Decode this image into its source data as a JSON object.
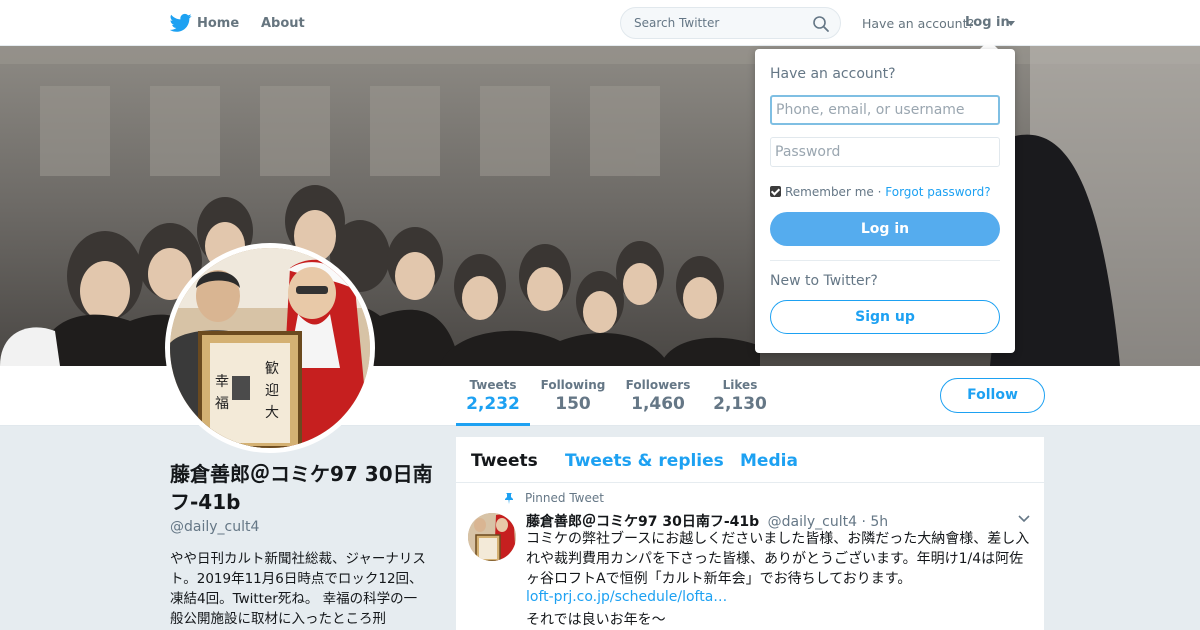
{
  "nav": {
    "home_label": "Home",
    "about_label": "About",
    "search_placeholder": "Search Twitter",
    "have_account": "Have an account?",
    "login_label": "Log in"
  },
  "icons": {
    "brand": "twitter-bird-icon",
    "search": "search-icon",
    "caret": "caret-down-icon",
    "pin": "pin-icon",
    "chevron": "chevron-down-icon"
  },
  "colors": {
    "accent": "#1da1f2",
    "login_button": "#55acee",
    "background": "#e6ecf0"
  },
  "profile": {
    "name": "藤倉善郎＠コミケ97 30日南フ-41b",
    "handle": "@daily_cult4",
    "bio": "やや日刊カルト新聞社総裁、ジャーナリスト。2019年11月6日時点でロック12回、凍結4回。Twitter死ね。 幸福の科学の一般公開施設に取材に入ったところ刑"
  },
  "stats": [
    {
      "label": "Tweets",
      "value": "2,232"
    },
    {
      "label": "Following",
      "value": "150"
    },
    {
      "label": "Followers",
      "value": "1,460"
    },
    {
      "label": "Likes",
      "value": "2,130"
    }
  ],
  "follow_label": "Follow",
  "timeline": {
    "tabs": [
      "Tweets",
      "Tweets & replies",
      "Media"
    ],
    "pinned_label": "Pinned Tweet",
    "tweet": {
      "name": "藤倉善郎＠コミケ97 30日南フ-41b",
      "handle": "@daily_cult4",
      "time": "· 5h",
      "text": "コミケの弊社ブースにお越しくださいました皆様、お隣だった大納會様、差し入れや裁判費用カンパを下さった皆様、ありがとうございます。年明け1/4は阿佐ヶ谷ロフトAで恒例「カルト新年会」でお待ちしております。",
      "link": "loft-prj.co.jp/schedule/lofta…",
      "more": "それでは良いお年を～"
    }
  },
  "login_dropdown": {
    "title": "Have an account?",
    "username_placeholder": "Phone, email, or username",
    "password_placeholder": "Password",
    "remember_label": "Remember me",
    "remember_checked": true,
    "separator": "·",
    "forgot_label": "Forgot password?",
    "login_button": "Log in",
    "new_to_label": "New to Twitter?",
    "signup_button": "Sign up"
  }
}
